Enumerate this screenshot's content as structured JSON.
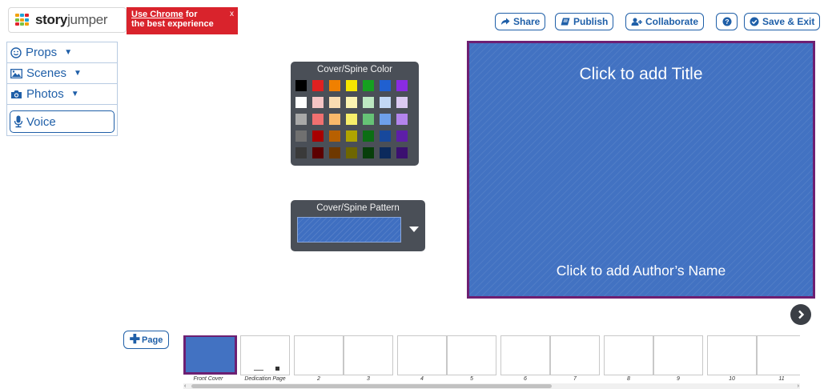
{
  "logo": {
    "prefix": "story",
    "suffix": "jumper"
  },
  "chrome_banner": {
    "link": "Use Chrome",
    "text_1": " for",
    "text_2": "the best experience",
    "close": "x"
  },
  "toolbar": {
    "share": "Share",
    "publish": "Publish",
    "collaborate": "Collaborate",
    "save_exit": "Save & Exit"
  },
  "menu": {
    "props": "Props",
    "scenes": "Scenes",
    "photos": "Photos",
    "voice": "Voice"
  },
  "color_panel": {
    "title": "Cover/Spine Color",
    "swatches": [
      "#000000",
      "#e02020",
      "#f08000",
      "#f5e500",
      "#16a020",
      "#2060d0",
      "#8a2be2",
      "#ffffff",
      "#f4c4c4",
      "#f9dcb2",
      "#fbf4b2",
      "#bde8c2",
      "#c2d8f5",
      "#dccaf2",
      "#a8a8a8",
      "#f07070",
      "#f8b86a",
      "#f7ee6a",
      "#66c276",
      "#6ea0ea",
      "#b384ec",
      "#707070",
      "#a80000",
      "#b86000",
      "#b0a400",
      "#0c6e14",
      "#17489c",
      "#5e1ea8",
      "#3a3a3a",
      "#5c0000",
      "#6e3800",
      "#6e6600",
      "#073e0a",
      "#0c2a5c",
      "#3b1070"
    ]
  },
  "pattern_panel": {
    "title": "Cover/Spine Pattern"
  },
  "cover": {
    "title": "Click to add Title",
    "author": "Click to add Author’s Name"
  },
  "page_button": {
    "label": "Page"
  },
  "thumbnails": [
    "Front Cover",
    "Dedication Page",
    "2",
    "3",
    "4",
    "5",
    "6",
    "7",
    "8",
    "9",
    "10",
    "11"
  ],
  "colors": {
    "accent": "#1f5fa8",
    "cover": "#4272c2",
    "cover_border": "#6d1f72",
    "banner": "#d9232c",
    "panel": "#4a4f57"
  }
}
